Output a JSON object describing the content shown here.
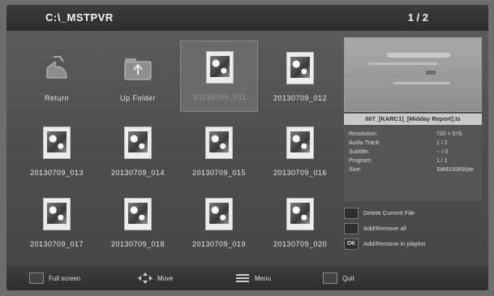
{
  "header": {
    "path": "C:\\_MSTPVR",
    "page": "1 / 2"
  },
  "grid": {
    "items": [
      {
        "label": "Return",
        "icon": "return-folder-icon",
        "selected": false
      },
      {
        "label": "Up Folder",
        "icon": "up-folder-icon",
        "selected": false
      },
      {
        "label": "20130709_011",
        "icon": "image-file-icon",
        "selected": true
      },
      {
        "label": "20130709_012",
        "icon": "image-file-icon",
        "selected": false
      },
      {
        "label": "20130709_013",
        "icon": "image-file-icon",
        "selected": false
      },
      {
        "label": "20130709_014",
        "icon": "image-file-icon",
        "selected": false
      },
      {
        "label": "20130709_015",
        "icon": "image-file-icon",
        "selected": false
      },
      {
        "label": "20130709_016",
        "icon": "image-file-icon",
        "selected": false
      },
      {
        "label": "20130709_017",
        "icon": "image-file-icon",
        "selected": false
      },
      {
        "label": "20130709_018",
        "icon": "image-file-icon",
        "selected": false
      },
      {
        "label": "20130709_019",
        "icon": "image-file-icon",
        "selected": false
      },
      {
        "label": "20130709_020",
        "icon": "image-file-icon",
        "selected": false
      }
    ]
  },
  "info": {
    "title": "007_[KARC1]_[Midday Report].ts",
    "rows": [
      {
        "key": "Resolution:",
        "value": "720 × 576"
      },
      {
        "key": "Audio Track:",
        "value": "1 / 2"
      },
      {
        "key": "Subtitle:",
        "value": "-- / 0"
      },
      {
        "key": "Program:",
        "value": "1 / 1"
      },
      {
        "key": "Size:",
        "value": "3366193KByte"
      }
    ]
  },
  "side_actions": [
    {
      "key": "",
      "label": "Delete Current File"
    },
    {
      "key": "",
      "label": "Add/Remove all"
    },
    {
      "key": "OK",
      "label": "Add/Remove in playlist"
    }
  ],
  "bottom_hints": [
    {
      "icon": "fullscreen-key-icon",
      "label": "Full screen"
    },
    {
      "icon": "dpad-move-icon",
      "label": "Move"
    },
    {
      "icon": "menu-key-icon",
      "label": "Menu"
    },
    {
      "icon": "exit-key-icon",
      "label": "Quit"
    }
  ]
}
